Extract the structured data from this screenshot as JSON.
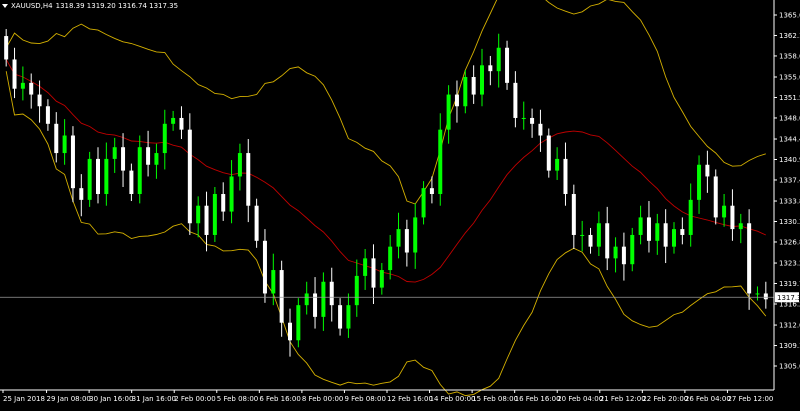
{
  "header": {
    "symbol": "XAUUSD,H4",
    "ohlc": "1318.39 1319.20 1316.74 1317.35"
  },
  "colors": {
    "background": "#000000",
    "axis": "#ffffff",
    "bull_candle": "#00ff00",
    "bear_candle": "#ffffff",
    "bollinger": "#d4b000",
    "moving_average": "#c00000",
    "price_line": "#9a9a9a",
    "price_label_bg": "#ffffff",
    "price_label_text": "#000000"
  },
  "price_axis": {
    "labels": [
      "1365.60",
      "1362.10",
      "1358.60",
      "1355.00",
      "1351.50",
      "1348.00",
      "1344.40",
      "1340.90",
      "1337.40",
      "1333.80",
      "1330.30",
      "1326.80",
      "1323.20",
      "1319.70",
      "1316.20",
      "1312.60",
      "1309.10",
      "1305.60"
    ],
    "current_price": "1317.35"
  },
  "time_axis": {
    "labels": [
      "25 Jan 2018",
      "29 Jan 08:00",
      "30 Jan 16:00",
      "31 Jan 16:00",
      "2 Feb 00:00",
      "5 Feb 08:00",
      "6 Feb 16:00",
      "8 Feb 00:00",
      "9 Feb 08:00",
      "12 Feb 16:00",
      "14 Feb 00:00",
      "15 Feb 08:00",
      "16 Feb 16:00",
      "20 Feb 04:00",
      "21 Feb 12:00",
      "22 Feb 20:00",
      "26 Feb 04:00",
      "27 Feb 12:00"
    ]
  },
  "chart_data": {
    "type": "candlestick",
    "symbol": "XAUUSD,H4",
    "ylim": [
      1305.6,
      1365.6
    ],
    "closes": [
      1358,
      1353,
      1354,
      1352,
      1350,
      1347,
      1342,
      1345,
      1336,
      1334,
      1341,
      1335,
      1341,
      1343,
      1339,
      1335,
      1343,
      1340,
      1342,
      1347,
      1348,
      1346,
      1330,
      1333,
      1328,
      1335,
      1332,
      1338,
      1342,
      1333,
      1327,
      1318,
      1322,
      1313,
      1310,
      1316,
      1318,
      1314,
      1320,
      1316,
      1312,
      1316,
      1321,
      1324,
      1319,
      1322,
      1326,
      1329,
      1325,
      1331,
      1336,
      1335,
      1346,
      1352,
      1350,
      1355,
      1352,
      1357,
      1356,
      1360,
      1354,
      1348,
      1348,
      1347,
      1345,
      1339,
      1341,
      1335,
      1328,
      1328,
      1326,
      1330,
      1324,
      1326,
      1323,
      1328,
      1331,
      1327,
      1330,
      1326,
      1329,
      1328,
      1334,
      1340,
      1338,
      1331,
      1333,
      1329,
      1330,
      1318,
      1318,
      1317
    ]
  }
}
